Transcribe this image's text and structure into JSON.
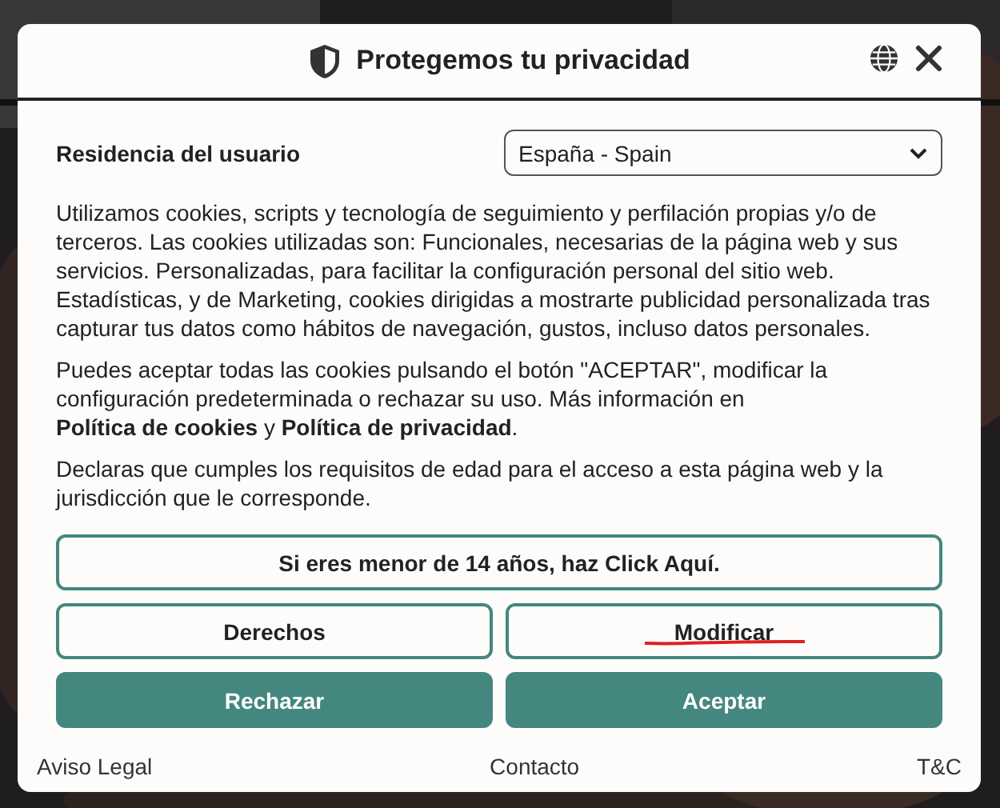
{
  "dialog": {
    "title": "Protegemos tu privacidad",
    "residence": {
      "label": "Residencia del usuario",
      "value": "España - Spain"
    },
    "paragraphs": [
      [
        {
          "text": "Utilizamos cookies, scripts y tecnología de seguimiento y perfilación propias y/o de terceros. Las cookies utilizadas son: Funcionales, necesarias de la página web y sus servicios. Personalizadas, para facilitar la configuración personal del sitio web. Estadísticas, y de Marketing, cookies dirigidas a mostrarte publicidad personalizada tras capturar tus datos como hábitos de navegación, gustos, incluso datos personales."
        }
      ],
      [
        {
          "text": "Puedes aceptar todas las cookies pulsando el botón \"ACEPTAR\", modificar la configuración predeterminada o rechazar su uso. Más información en "
        },
        {
          "link": "Política de cookies"
        },
        {
          "text": " y "
        },
        {
          "link": "Política de privacidad"
        },
        {
          "text": "."
        }
      ],
      [
        {
          "text": "Declaras que cumples los requisitos de edad para el acceso a esta página web y la jurisdicción que le corresponde."
        }
      ]
    ],
    "minor_button": "Si eres menor de 14 años, haz Click Aquí.",
    "buttons": [
      {
        "label": "Derechos",
        "kind": "outline",
        "underlined": false
      },
      {
        "label": "Modificar",
        "kind": "outline",
        "underlined": true
      },
      {
        "label": "Rechazar",
        "kind": "filled",
        "underlined": false
      },
      {
        "label": "Aceptar",
        "kind": "filled",
        "underlined": false
      }
    ],
    "footer_links": [
      "Aviso Legal",
      "Contacto",
      "T&C"
    ]
  }
}
